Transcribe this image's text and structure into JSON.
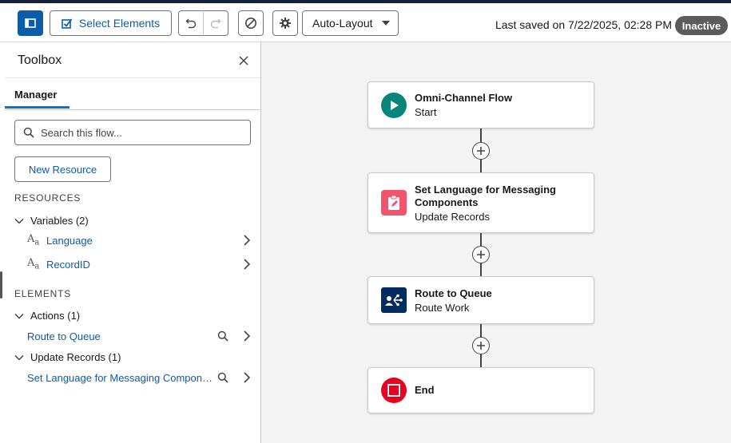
{
  "header": {
    "select_elements_label": "Select Elements",
    "auto_layout_value": "Auto-Layout",
    "last_saved": "Last saved on 7/22/2025, 02:28 PM",
    "status": "Inactive"
  },
  "toolbox": {
    "title": "Toolbox",
    "tab_manager": "Manager",
    "search_placeholder": "Search this flow...",
    "new_resource_label": "New Resource",
    "resources_heading": "RESOURCES",
    "variables_group": "Variables (2)",
    "variables": [
      "Language",
      "RecordID"
    ],
    "variable_type_glyph": "A",
    "variable_type_glyph_sub": "a",
    "elements_heading": "ELEMENTS",
    "actions_group": "Actions (1)",
    "actions": [
      "Route to Queue"
    ],
    "update_group": "Update Records (1)",
    "updates": [
      "Set Language for Messaging Components"
    ]
  },
  "flow": {
    "nodes": [
      {
        "title": "Omni-Channel Flow",
        "subtitle": "Start",
        "icon": "play-icon",
        "color": "#06857a"
      },
      {
        "title": "Set Language for Messaging Components",
        "subtitle": "Update Records",
        "icon": "clipboard-edit-icon",
        "color": "#f2536d"
      },
      {
        "title": "Route to Queue",
        "subtitle": "Route Work",
        "icon": "route-work-icon",
        "color": "#032d60"
      },
      {
        "title": "End",
        "subtitle": "",
        "icon": "stop-icon",
        "color": "#ea001e"
      }
    ]
  },
  "colors": {
    "brand": "#0b5cab",
    "accent": "#0176d3",
    "badge": "#5c5c5c",
    "header_stripe": "#14213d"
  }
}
